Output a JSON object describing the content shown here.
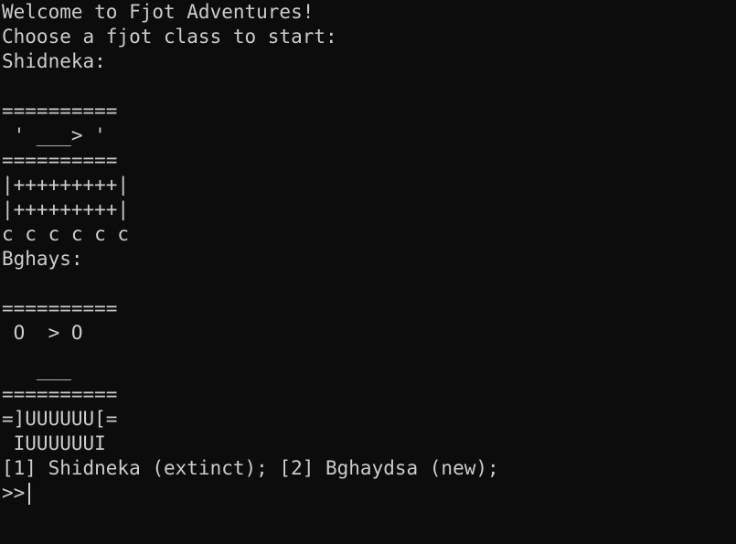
{
  "theme": {
    "background": "#0c0c0c",
    "foreground": "#cccccc"
  },
  "output": {
    "lines": [
      "Welcome to Fjot Adventures!",
      "Choose a fjot class to start:",
      "Shidneka:",
      "",
      "==========",
      " ' ___> '",
      "==========",
      "|+++++++++|",
      "|+++++++++|",
      "c c c c c c",
      "Bghays:",
      "",
      "==========",
      " O  > O",
      "",
      "   ___",
      "==========",
      "=]UUUUUU[=",
      " IUUUUUUI",
      "[1] Shidneka (extinct); [2] Bghaydsa (new);"
    ]
  },
  "prompt": {
    "symbol": ">>",
    "input_value": ""
  }
}
